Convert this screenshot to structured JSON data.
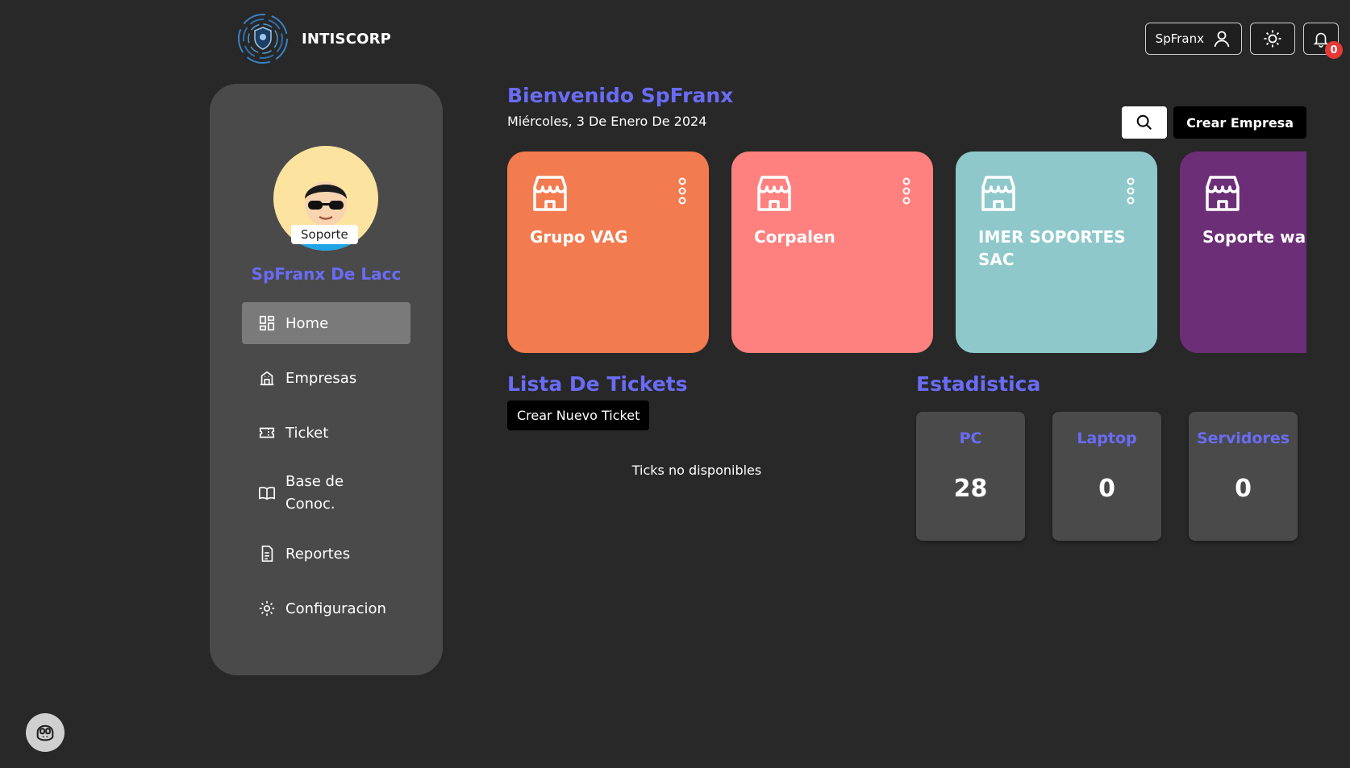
{
  "brand": {
    "name": "INTISCORP"
  },
  "topbar": {
    "username": "SpFranx",
    "notification_count": "0"
  },
  "sidebar": {
    "role": "Soporte",
    "profile_name": "SpFranx De Lacc",
    "items": [
      {
        "label": "Home",
        "icon": "dashboard-icon",
        "active": true
      },
      {
        "label": "Empresas",
        "icon": "building-icon"
      },
      {
        "label": "Ticket",
        "icon": "ticket-icon"
      },
      {
        "label": "Base de Conoc.",
        "icon": "book-icon"
      },
      {
        "label": "Reportes",
        "icon": "document-icon"
      },
      {
        "label": "Configuracion",
        "icon": "gear-icon"
      }
    ]
  },
  "header": {
    "greeting": "Bienvenido SpFranx",
    "date": "Miércoles, 3 De Enero De 2024",
    "create_company_label": "Crear Empresa"
  },
  "companies": [
    {
      "name": "Grupo VAG",
      "color": "#f27b50"
    },
    {
      "name": "Corpalen",
      "color": "#fe8180"
    },
    {
      "name": "IMER SOPORTES SAC",
      "color": "#8ec8ca"
    },
    {
      "name": "Soporte war",
      "color": "#6c2e77"
    }
  ],
  "tickets": {
    "title": "Lista De Tickets",
    "new_label": "Crear Nuevo Ticket",
    "empty_text": "Ticks no disponibles"
  },
  "stats": {
    "title": "Estadistica",
    "items": [
      {
        "label": "PC",
        "value": "28"
      },
      {
        "label": "Laptop",
        "value": "0"
      },
      {
        "label": "Servidores",
        "value": "0"
      }
    ]
  }
}
